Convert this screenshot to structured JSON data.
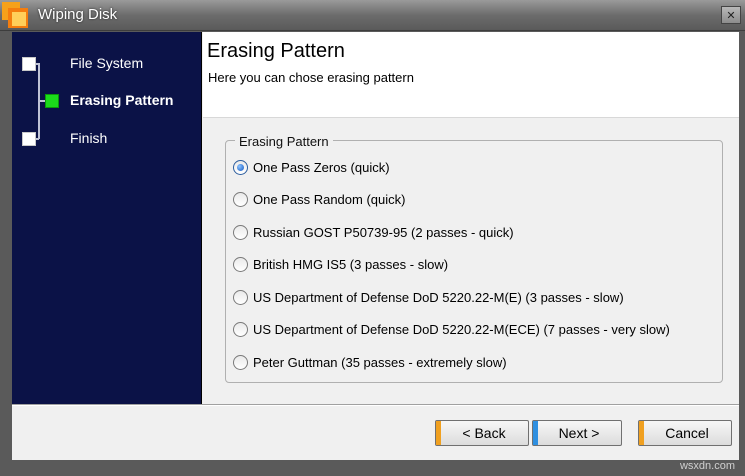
{
  "window": {
    "title": "Wiping Disk",
    "close_glyph": "✕"
  },
  "sidebar": {
    "steps": [
      {
        "label": "File System",
        "state": "done"
      },
      {
        "label": "Erasing Pattern",
        "state": "current"
      },
      {
        "label": "Finish",
        "state": "pending"
      }
    ]
  },
  "header": {
    "title": "Erasing Pattern",
    "subtitle": "Here you can chose erasing pattern"
  },
  "pattern_group": {
    "label": "Erasing Pattern",
    "selected_index": 0,
    "options": [
      "One Pass Zeros (quick)",
      "One Pass Random (quick)",
      "Russian GOST P50739-95 (2 passes - quick)",
      "British HMG IS5 (3 passes - slow)",
      "US Department of Defense DoD 5220.22-M(E) (3 passes - slow)",
      "US Department of Defense DoD 5220.22-M(ECE) (7 passes - very slow)",
      "Peter Guttman (35 passes - extremely slow)"
    ]
  },
  "buttons": {
    "back": "< Back",
    "next": "Next >",
    "cancel": "Cancel"
  },
  "colors": {
    "sidebar_bg": "#0b1247",
    "current_step_marker": "#1bdc1b",
    "back_accent": "#f0a020",
    "next_accent": "#2e8fe0",
    "cancel_accent": "#f0a020"
  },
  "watermark": "wsxdn.com"
}
